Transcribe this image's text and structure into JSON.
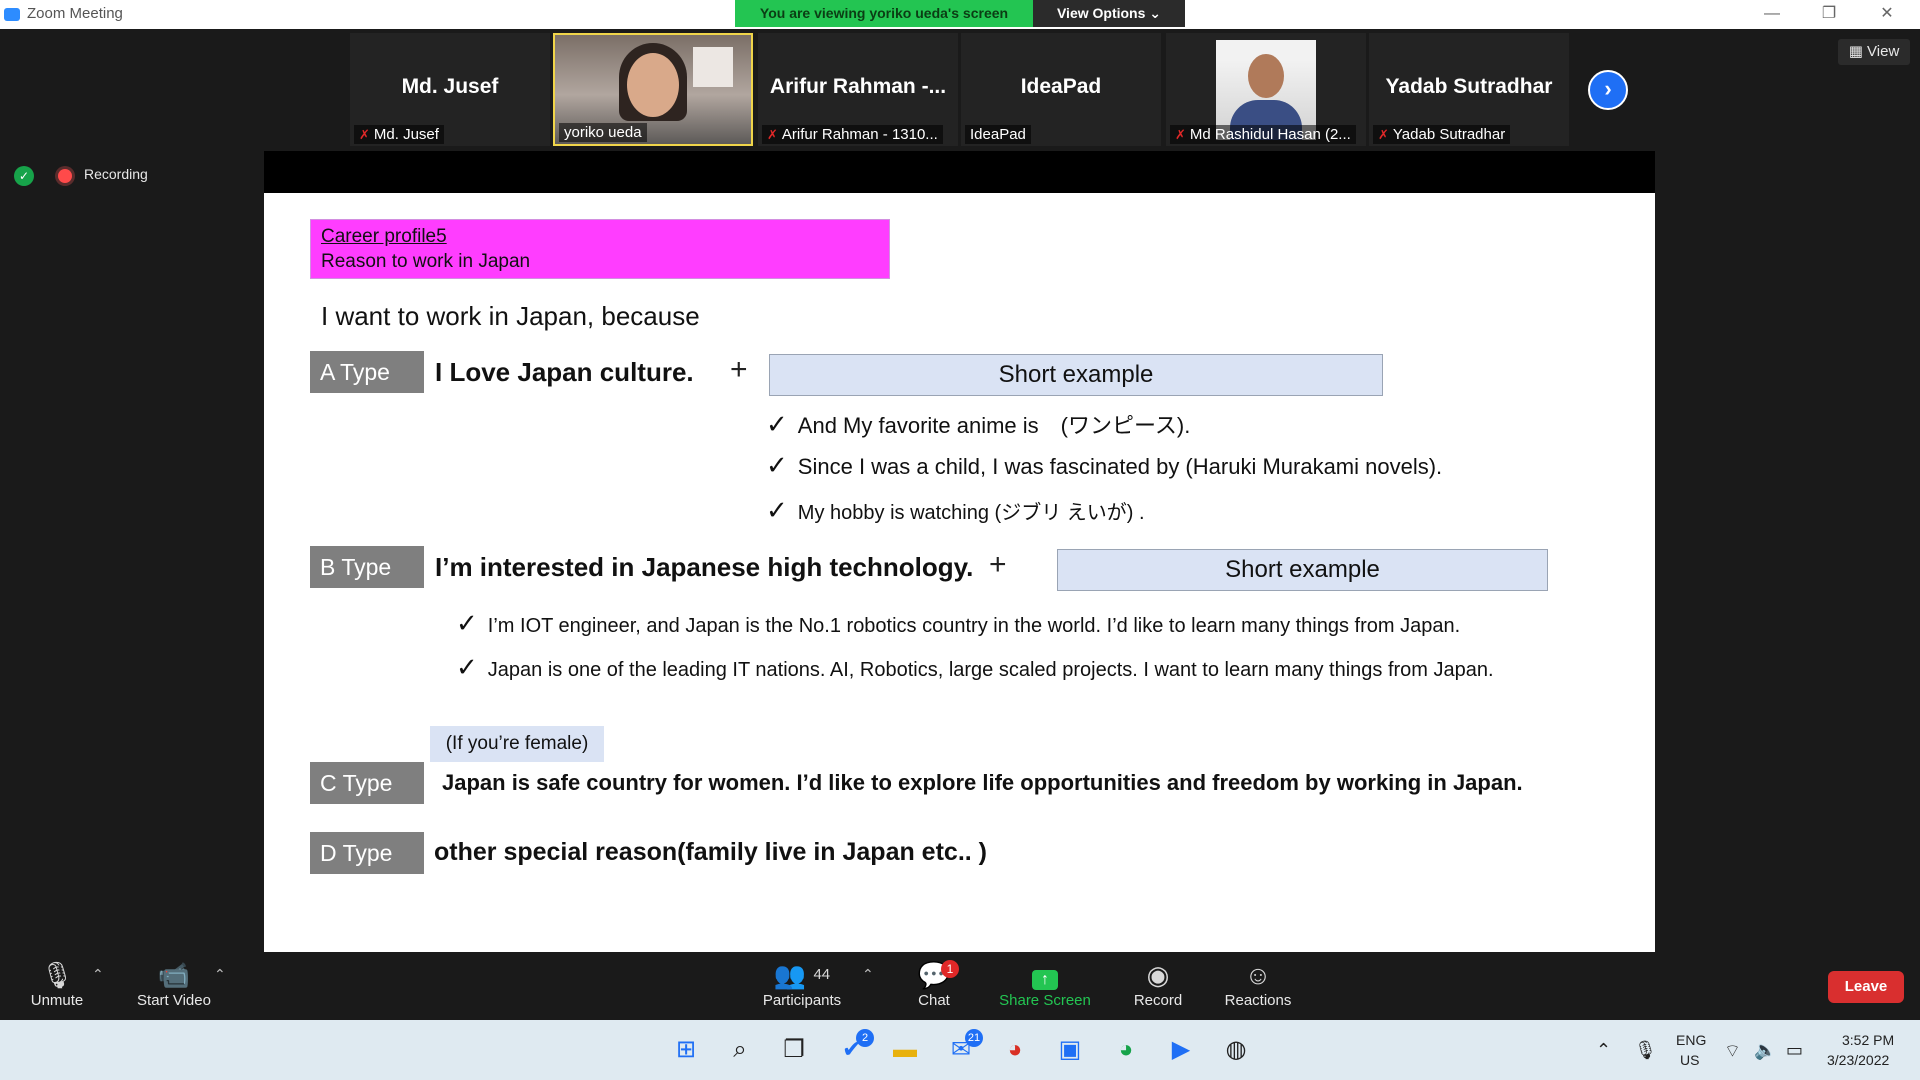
{
  "window": {
    "title": "Zoom Meeting",
    "banner": "You are viewing yoriko ueda's screen",
    "view_options": "View Options ⌄",
    "controls": [
      "—",
      "❐",
      "✕"
    ]
  },
  "participants": [
    {
      "name": "Md. Jusef",
      "label": "Md. Jusef",
      "muted": true,
      "video": false
    },
    {
      "name": "",
      "label": "yoriko ueda",
      "muted": false,
      "video": true,
      "active": true
    },
    {
      "name": "Arifur  Rahman  -...",
      "label": "Arifur Rahman - 1310...",
      "muted": true,
      "video": false
    },
    {
      "name": "IdeaPad",
      "label": "IdeaPad",
      "muted": false,
      "video": false
    },
    {
      "name": "",
      "label": "Md Rashidul Hasan (2...",
      "muted": true,
      "video": true
    },
    {
      "name": "Yadab Sutradhar",
      "label": "Yadab Sutradhar",
      "muted": true,
      "video": false
    }
  ],
  "view_button": "View",
  "recording": "Recording",
  "slide": {
    "header_link": "Career profile5",
    "header_sub": "Reason to work in Japan",
    "intro": "I want to work in Japan, because",
    "a_type": "A Type",
    "a_headline": "I Love Japan culture.",
    "plus": "+",
    "short_example": "Short example",
    "a_bullets": [
      "And My favorite anime is　(ワンピース).",
      "Since I was a child, I was fascinated by (Haruki Murakami novels).",
      "My hobby is watching (ジブリ えいが) ."
    ],
    "b_type": "B Type",
    "b_headline": "I’m interested in Japanese high technology.",
    "b_bullets": [
      "I’m IOT engineer, and Japan is the No.1 robotics country in the world. I’d like to learn many things from Japan.",
      "Japan is one of the leading IT nations. AI, Robotics, large scaled projects. I want to learn many things from Japan."
    ],
    "female_note": "(If you’re female)",
    "c_type": "C Type",
    "c_headline": "Japan is safe country for women. I’d like to explore life opportunities and freedom by working in Japan.",
    "d_type": "D Type",
    "d_headline": "other special reason(family live in Japan etc.. )",
    "check": "✓"
  },
  "toolbar": {
    "unmute": "Unmute",
    "start_video": "Start Video",
    "participants": "Participants",
    "participant_count": "44",
    "chat": "Chat",
    "chat_badge": "1",
    "share_screen": "Share Screen",
    "record": "Record",
    "reactions": "Reactions",
    "leave": "Leave"
  },
  "taskbar": {
    "badges": {
      "todo": "2",
      "mail": "21"
    },
    "lang_top": "ENG",
    "lang_bottom": "US",
    "time": "3:52 PM",
    "date": "3/23/2022"
  },
  "colors": {
    "banner_green": "#23c552",
    "pink_header": "#ff3dff",
    "type_box_gray": "#7f7f7f",
    "short_example_blue": "#dae3f4",
    "leave_red": "#d92f2f",
    "zoom_blue": "#1f6ff5"
  },
  "icons": [
    "zoom-app-icon",
    "mic-muted-icon",
    "video-off-icon",
    "participants-icon",
    "chat-icon",
    "share-screen-icon",
    "record-icon",
    "reactions-icon",
    "shield-icon",
    "recording-dot-icon",
    "chevron-right-icon",
    "grid-view-icon",
    "windows-start-icon",
    "search-icon",
    "task-view-icon",
    "todo-icon",
    "file-explorer-icon",
    "mail-icon",
    "chrome-icon",
    "store-icon",
    "chrome-profile-icon",
    "zoom-taskbar-icon",
    "obs-icon",
    "wifi-icon",
    "volume-icon",
    "battery-icon",
    "microphone-tray-icon",
    "chevron-up-icon"
  ]
}
